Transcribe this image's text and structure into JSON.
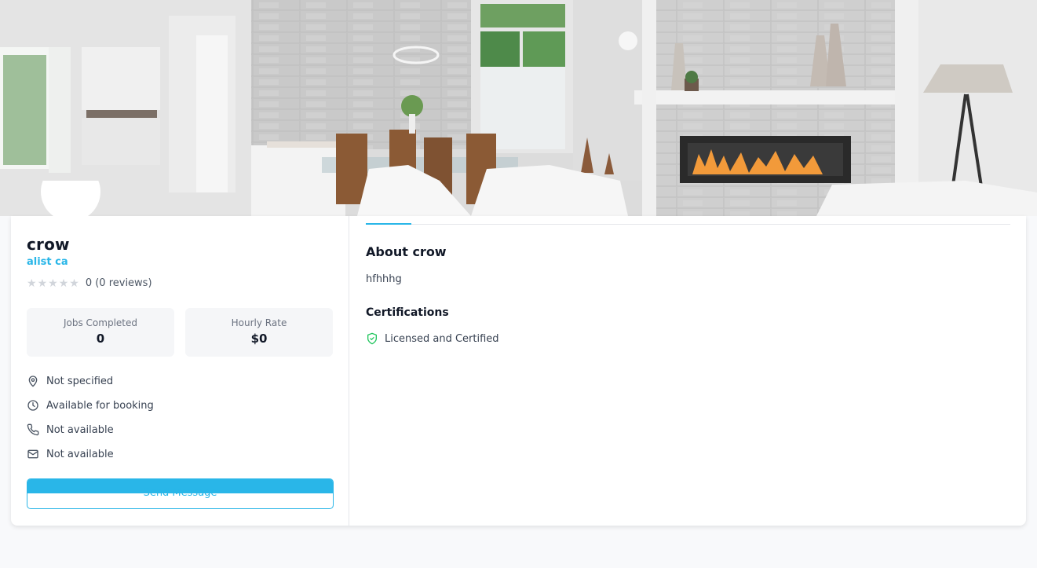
{
  "profile": {
    "name": "crow",
    "company": "alist ca",
    "rating_text": "0 (0 reviews)",
    "stars": 5
  },
  "stats": {
    "jobs_label": "Jobs Completed",
    "jobs_value": "0",
    "rate_label": "Hourly Rate",
    "rate_value": "$0"
  },
  "info": {
    "location": "Not specified",
    "availability": "Available for booking",
    "phone": "Not available",
    "email": "Not available"
  },
  "actions": {
    "send_message": "Send Message"
  },
  "about": {
    "title": "About crow",
    "text": "hfhhhg"
  },
  "certifications": {
    "title": "Certifications",
    "item": "Licensed and Certified"
  },
  "colors": {
    "accent": "#29b6e8",
    "success": "#22c55e",
    "background": "#f8f9fb"
  }
}
